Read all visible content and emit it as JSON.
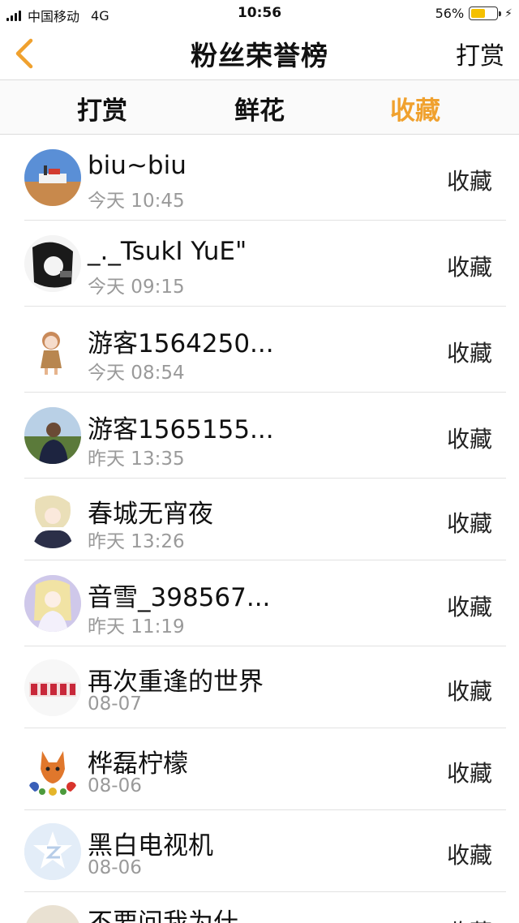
{
  "status_bar": {
    "carrier": "中国移动",
    "network": "4G",
    "time": "10:56",
    "battery_percent": "56%",
    "battery_level": 0.56
  },
  "nav": {
    "title": "粉丝荣誉榜",
    "action_label": "打赏"
  },
  "tabs": [
    {
      "label": "打赏",
      "active": false
    },
    {
      "label": "鲜花",
      "active": false
    },
    {
      "label": "收藏",
      "active": true
    }
  ],
  "accent_color": "#f0a12e",
  "fans": [
    {
      "name": "biu~biu",
      "time": "今天 10:45",
      "action": "收藏"
    },
    {
      "name": "_._TsukI YuE\"",
      "time": "今天 09:15",
      "action": "收藏"
    },
    {
      "name": "游客1564250...",
      "time": "今天 08:54",
      "action": "收藏"
    },
    {
      "name": "游客1565155...",
      "time": "昨天 13:35",
      "action": "收藏"
    },
    {
      "name": "春城无宵夜",
      "time": "昨天 13:26",
      "action": "收藏"
    },
    {
      "name": "音雪_398567...",
      "time": "昨天 11:19",
      "action": "收藏"
    },
    {
      "name": "再次重逢的世界",
      "time": "08-07",
      "action": "收藏"
    },
    {
      "name": "桦磊柠檬",
      "time": "08-06",
      "action": "收藏"
    },
    {
      "name": "黑白电视机",
      "time": "08-06",
      "action": "收藏"
    },
    {
      "name": "不要问我为什",
      "time": "",
      "action": "收藏"
    }
  ]
}
